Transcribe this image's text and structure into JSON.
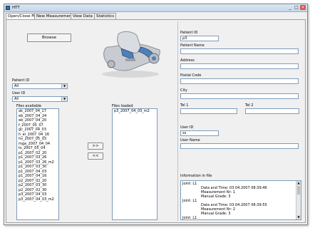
{
  "window": {
    "title": "HTT",
    "buttons": [
      "_",
      "□",
      "×"
    ]
  },
  "tabs": [
    "Open/Close File",
    "New Measurement",
    "View Data",
    "Statistics"
  ],
  "left": {
    "browse_label": "Browse",
    "patient_id_label": "Patient ID",
    "patient_id_value": "All",
    "user_id_label": "User ID",
    "user_id_value": "All",
    "files_available_label": "Files available",
    "files_loaded_label": "Files loaded",
    "move_right_label": ">>",
    "move_left_label": "<<",
    "files_available": [
      "ak_2007_04_17",
      "eb_2007_04_24",
      "eb_2007_04_20",
      "f_2007_05_07",
      "gc_2007_04_03",
      "h_ei_2007_04_16",
      "hv_2007_05_03",
      "mga_2007_04_04",
      "ts_2007_05_04",
      "p1_2007_02_20",
      "p1_2007_03_26",
      "p1_2007_03_26_m2",
      "p1_2007_03_30",
      "p1_2007_04_03",
      "p1_2007_04_16",
      "p2_2007_02_20",
      "p2_2007_03_30",
      "p2_2007_02_30",
      "p3_2007_04_03",
      "p3_2007_04_03_m2"
    ],
    "files_loaded": [
      "p3_2007_04_03_m2"
    ]
  },
  "right": {
    "patient_id_label": "Patient ID",
    "patient_id_value": "p3",
    "patient_name_label": "Patient Name",
    "patient_name_value": "",
    "address_label": "Address",
    "address_value": "",
    "postal_code_label": "Postal Code",
    "postal_code_value": "",
    "city_label": "City",
    "city_value": "",
    "tel1_label": "Tel 1",
    "tel1_value": "",
    "tel2_label": "Tel 2",
    "tel2_value": "",
    "user_id_label": "User ID",
    "user_id_value": "ss",
    "user_name_label": "User Name",
    "user_name_value": "",
    "info_label": "Information in file",
    "info_lines": [
      {
        "text": "Joint: L1",
        "indent": false
      },
      {
        "text": "Data and Time: 03.04.2007 08:39:46",
        "indent": true
      },
      {
        "text": "Measurement Nr: 1",
        "indent": true
      },
      {
        "text": "Manual Grade: 3",
        "indent": true
      },
      {
        "text": "Joint: L1",
        "indent": false
      },
      {
        "text": "Data and Time: 03.04.2007 08:39:55",
        "indent": true
      },
      {
        "text": "Measurement Nr: 2",
        "indent": true
      },
      {
        "text": "Manual Grade: 3",
        "indent": true
      },
      {
        "text": "Joint: L1",
        "indent": false
      },
      {
        "text": "Data and Time: 03.04.2007 08:40:05",
        "indent": true
      },
      {
        "text": "Measurement Nr: 3",
        "indent": true
      }
    ]
  },
  "colors": {
    "accent": "#3a6fb0",
    "device_body": "#c8ccd2",
    "device_blue": "#4e7fb8"
  }
}
